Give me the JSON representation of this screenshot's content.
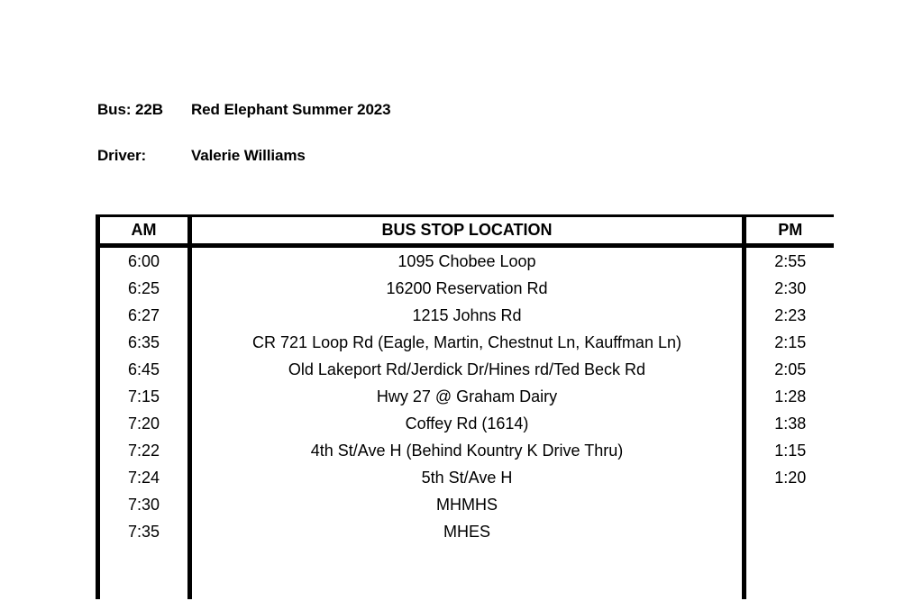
{
  "document": {
    "bus_label": "Bus: 22B",
    "bus_value": "Red Elephant Summer 2023",
    "driver_label": "Driver:",
    "driver_value": "Valerie Williams"
  },
  "table": {
    "headers": {
      "am": "AM",
      "location": "BUS STOP LOCATION",
      "pm": "PM"
    },
    "rows": [
      {
        "am": "6:00",
        "location": "1095 Chobee Loop",
        "pm": "2:55"
      },
      {
        "am": "6:25",
        "location": "16200 Reservation Rd",
        "pm": "2:30"
      },
      {
        "am": "6:27",
        "location": "1215 Johns Rd",
        "pm": "2:23"
      },
      {
        "am": "6:35",
        "location": "CR 721 Loop Rd (Eagle, Martin, Chestnut Ln, Kauffman Ln)",
        "pm": "2:15"
      },
      {
        "am": "6:45",
        "location": "Old Lakeport Rd/Jerdick Dr/Hines rd/Ted Beck Rd",
        "pm": "2:05"
      },
      {
        "am": "7:15",
        "location": "Hwy 27 @ Graham Dairy",
        "pm": "1:28"
      },
      {
        "am": "7:20",
        "location": "Coffey Rd (1614)",
        "pm": "1:38"
      },
      {
        "am": "7:22",
        "location": "4th St/Ave H (Behind Kountry K Drive Thru)",
        "pm": "1:15"
      },
      {
        "am": "7:24",
        "location": "5th St/Ave H",
        "pm": "1:20"
      },
      {
        "am": "7:30",
        "location": "MHMHS",
        "pm": ""
      },
      {
        "am": "7:35",
        "location": "MHES",
        "pm": ""
      },
      {
        "am": "",
        "location": "",
        "pm": ""
      },
      {
        "am": "",
        "location": "",
        "pm": ""
      }
    ]
  },
  "colors": {
    "background": "#ffffff",
    "text": "#000000",
    "border": "#000000"
  }
}
